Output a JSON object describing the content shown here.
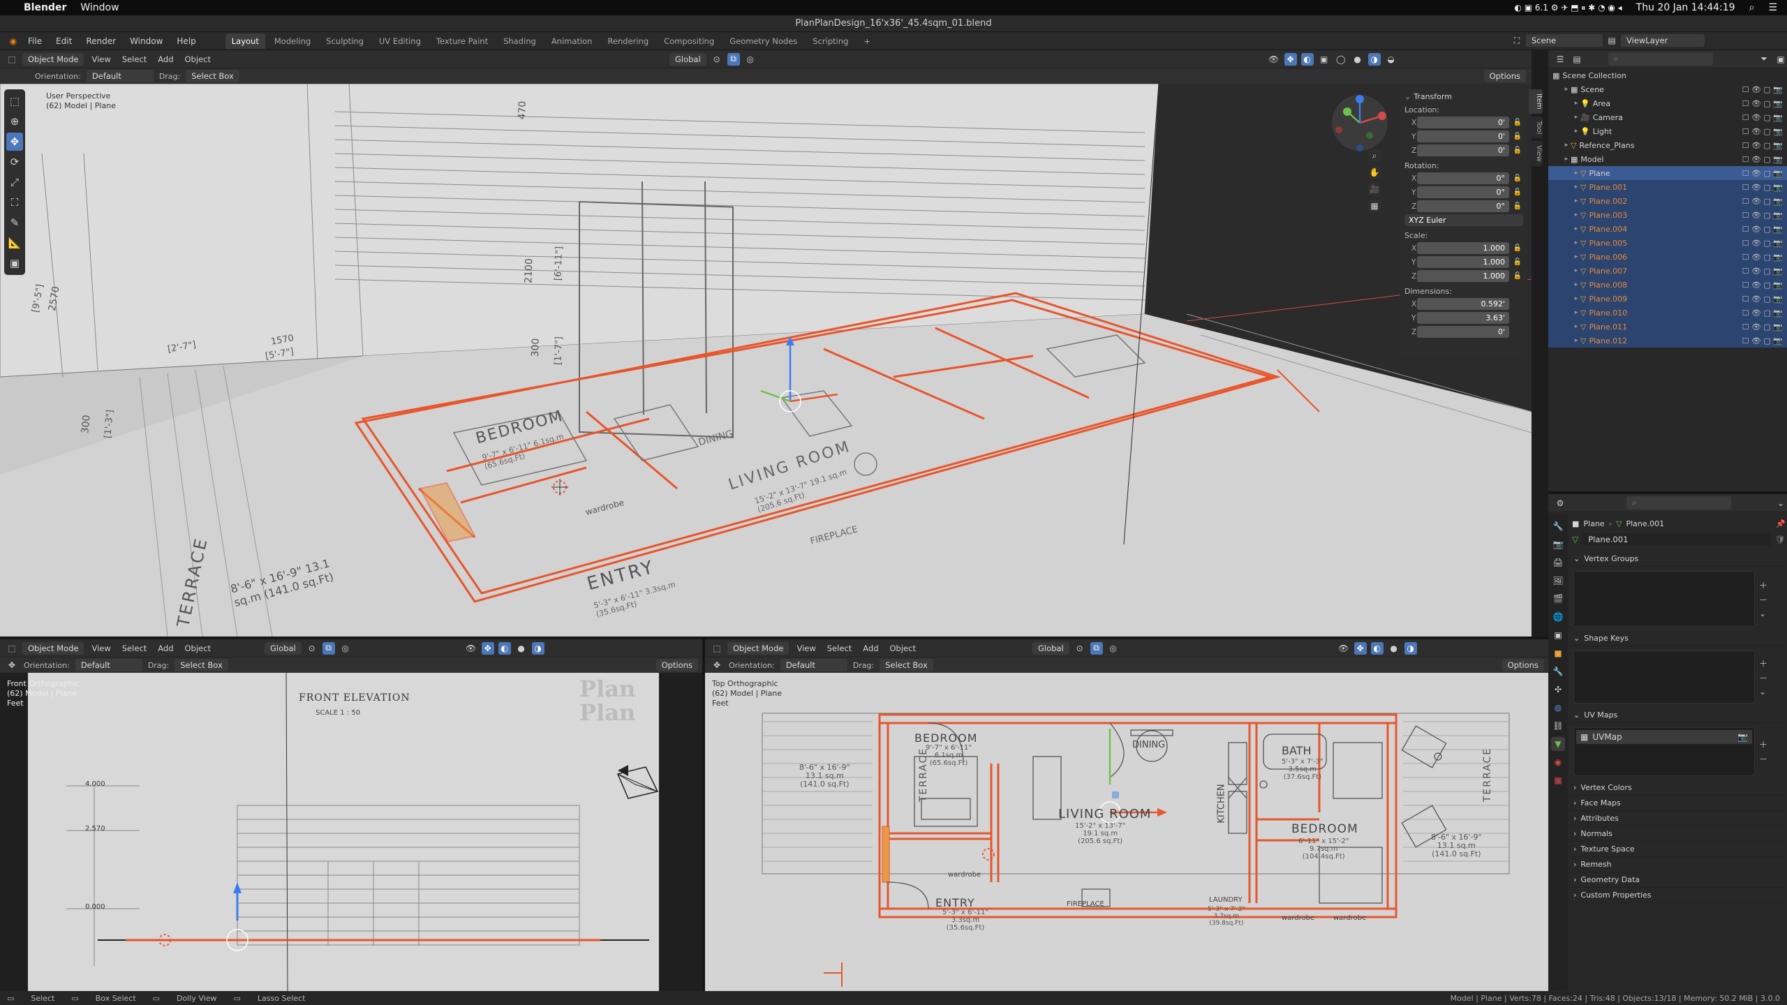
{
  "macos": {
    "app_name": "Blender",
    "menu": [
      "Window"
    ],
    "status_icons": "6.1",
    "datetime": "Thu 20 Jan  14:44:19"
  },
  "title": "PlanPlanDesign_16'x36'_45.4sqm_01.blend",
  "menu": [
    "File",
    "Edit",
    "Render",
    "Window",
    "Help"
  ],
  "workspaces": [
    "Layout",
    "Modeling",
    "Sculpting",
    "UV Editing",
    "Texture Paint",
    "Shading",
    "Animation",
    "Rendering",
    "Compositing",
    "Geometry Nodes",
    "Scripting",
    "+"
  ],
  "scene_name": "Scene",
  "view_layer": "ViewLayer",
  "viewport_main": {
    "mode": "Object Mode",
    "menus": [
      "View",
      "Select",
      "Add",
      "Object"
    ],
    "transform_orientation": "Global",
    "orientation_label": "Orientation:",
    "orientation_value": "Default",
    "drag_label": "Drag:",
    "drag_value": "Select Box",
    "options": "Options",
    "overlay_title": "User Perspective",
    "overlay_subtitle": "(62) Model | Plane",
    "plan_labels": {
      "bedroom": "BEDROOM",
      "bedroom_sub": "9'-7\" x 6'-11\" 6.1sq.m (65.6sq.Ft)",
      "living": "LIVING ROOM",
      "living_sub": "15'-2\" x 13'-7\" 19.1 sq.m (205.6 sq.Ft)",
      "entry": "ENTRY",
      "entry_sub": "5'-3\" x 6'-11\" 3.3sq.m (35.6sq.Ft)",
      "terrace": "TERRACE",
      "terrace_sub": "8'-6\" x 16'-9\" 13.1 sq.m (141.0 sq.Ft)",
      "fireplace": "FIREPLACE",
      "dining": "DINING",
      "wardrobe": "wardrobe"
    },
    "dims": [
      "470",
      "2100",
      "300",
      "300",
      "2570",
      "1570",
      "[9'-5\"]",
      "[6'-11\"]",
      "[2'-7\"]",
      "[5'-7\"]",
      "[1'-7\"]",
      "[1'-3\"]"
    ]
  },
  "npanel": {
    "tabs": [
      "Item",
      "Tool",
      "View"
    ],
    "section": "Transform",
    "location_label": "Location:",
    "location": {
      "x": "0'",
      "y": "0'",
      "z": "0'"
    },
    "rotation_label": "Rotation:",
    "rotation": {
      "x": "0°",
      "y": "0°",
      "z": "0°"
    },
    "rotation_mode": "XYZ Euler",
    "scale_label": "Scale:",
    "scale": {
      "x": "1.000",
      "y": "1.000",
      "z": "1.000"
    },
    "dimensions_label": "Dimensions:",
    "dimensions": {
      "x": "0.592'",
      "y": "3.63'",
      "z": "0'"
    },
    "axis": [
      "X",
      "Y",
      "Z"
    ]
  },
  "viewport_front": {
    "mode": "Object Mode",
    "menus": [
      "View",
      "Select",
      "Add",
      "Object"
    ],
    "transform_orientation": "Global",
    "orientation_label": "Orientation:",
    "orientation_value": "Default",
    "drag_label": "Drag:",
    "drag_value": "Select Box",
    "options": "Options",
    "overlay_title": "Front Orthographic",
    "overlay_subtitle": "(62) Model | Plane",
    "overlay_units": "Feet",
    "drawing_title": "FRONT ELEVATION",
    "drawing_scale": "SCALE 1 : 50",
    "watermark": "Plan Plan",
    "levels": [
      "4.000",
      "2.570",
      "0.000"
    ]
  },
  "viewport_top": {
    "mode": "Object Mode",
    "menus": [
      "View",
      "Select",
      "Add",
      "Object"
    ],
    "transform_orientation": "Global",
    "orientation_label": "Orientation:",
    "orientation_value": "Default",
    "drag_label": "Drag:",
    "drag_value": "Select Box",
    "options": "Options",
    "overlay_title": "Top Orthographic",
    "overlay_subtitle": "(62) Model | Plane",
    "overlay_units": "Feet",
    "rooms": {
      "bedroom1": "BEDROOM",
      "bedroom1_sub1": "9'-7\" x 6'-11\"",
      "bedroom1_sub2": "6.1sq.m",
      "bedroom1_sub3": "(65.6sq.Ft)",
      "dining": "DINING",
      "living": "LIVING ROOM",
      "living_sub1": "15'-2\" x 13'-7\"",
      "living_sub2": "19.1 sq.m",
      "living_sub3": "(205.6 sq.Ft)",
      "kitchen": "KITCHEN",
      "bath": "BATH",
      "bath_sub1": "5'-3\" x 7'-3\"",
      "bath_sub2": "3.5sq.m",
      "bath_sub3": "(37.6sq.Ft)",
      "bedroom2": "BEDROOM",
      "bedroom2_sub1": "6'-11\" x 15'-2\"",
      "bedroom2_sub2": "9.7sq.m",
      "bedroom2_sub3": "(104.4sq.Ft)",
      "entry": "ENTRY",
      "entry_sub1": "5'-3\" x 6'-11\"",
      "entry_sub2": "3.3sq.m",
      "entry_sub3": "(35.6sq.Ft)",
      "fireplace": "FIREPLACE",
      "laundry": "LAUNDRY",
      "laundry_sub1": "5'-3\" x 7'-2\"",
      "laundry_sub2": "3.7sq.m",
      "laundry_sub3": "(39.8sq.Ft)",
      "wardrobe": "wardrobe",
      "terrace": "TERRACE",
      "terrace_sub1": "8'-6\" x 16'-9\"",
      "terrace_sub2": "13.1 sq.m",
      "terrace_sub3": "(141.0 sq.Ft)"
    }
  },
  "outliner": {
    "search_placeholder": "",
    "root": "Scene Collection",
    "items": [
      {
        "name": "Scene",
        "depth": 1,
        "type": "collection",
        "sel": false
      },
      {
        "name": "Area",
        "depth": 2,
        "type": "light",
        "sel": false
      },
      {
        "name": "Camera",
        "depth": 2,
        "type": "camera",
        "sel": false
      },
      {
        "name": "Light",
        "depth": 2,
        "type": "light",
        "sel": false
      },
      {
        "name": "Refence_Plans",
        "depth": 1,
        "type": "mesh",
        "sel": false
      },
      {
        "name": "Model",
        "depth": 1,
        "type": "collection",
        "sel": false
      },
      {
        "name": "Plane",
        "depth": 2,
        "type": "mesh",
        "sel": "active"
      },
      {
        "name": "Plane.001",
        "depth": 2,
        "type": "mesh",
        "sel": true
      },
      {
        "name": "Plane.002",
        "depth": 2,
        "type": "mesh",
        "sel": true
      },
      {
        "name": "Plane.003",
        "depth": 2,
        "type": "mesh",
        "sel": true
      },
      {
        "name": "Plane.004",
        "depth": 2,
        "type": "mesh",
        "sel": true
      },
      {
        "name": "Plane.005",
        "depth": 2,
        "type": "mesh",
        "sel": true
      },
      {
        "name": "Plane.006",
        "depth": 2,
        "type": "mesh",
        "sel": true
      },
      {
        "name": "Plane.007",
        "depth": 2,
        "type": "mesh",
        "sel": true
      },
      {
        "name": "Plane.008",
        "depth": 2,
        "type": "mesh",
        "sel": true
      },
      {
        "name": "Plane.009",
        "depth": 2,
        "type": "mesh",
        "sel": true
      },
      {
        "name": "Plane.010",
        "depth": 2,
        "type": "mesh",
        "sel": true
      },
      {
        "name": "Plane.011",
        "depth": 2,
        "type": "mesh",
        "sel": true
      },
      {
        "name": "Plane.012",
        "depth": 2,
        "type": "mesh",
        "sel": true
      }
    ]
  },
  "properties": {
    "breadcrumb_object": "Plane",
    "breadcrumb_data": "Plane.001",
    "data_name": "Plane.001",
    "sections": {
      "vertex_groups": "Vertex Groups",
      "shape_keys": "Shape Keys",
      "uv_maps": "UV Maps",
      "uv_map_item": "UVMap",
      "collapsed": [
        "Vertex Colors",
        "Face Maps",
        "Attributes",
        "Normals",
        "Texture Space",
        "Remesh",
        "Geometry Data",
        "Custom Properties"
      ]
    }
  },
  "statusbar": {
    "select": "Select",
    "box_select": "Box Select",
    "dolly": "Dolly View",
    "lasso": "Lasso Select",
    "stats": "Model | Plane | Verts:78 | Faces:24 | Tris:48 | Objects:13/18 | Memory: 50.2 MiB | 3.0.0"
  },
  "colors": {
    "accent_blue": "#4c77b8",
    "selection_orange": "#e8552c",
    "viewport_bg": "#c9c9c9"
  }
}
